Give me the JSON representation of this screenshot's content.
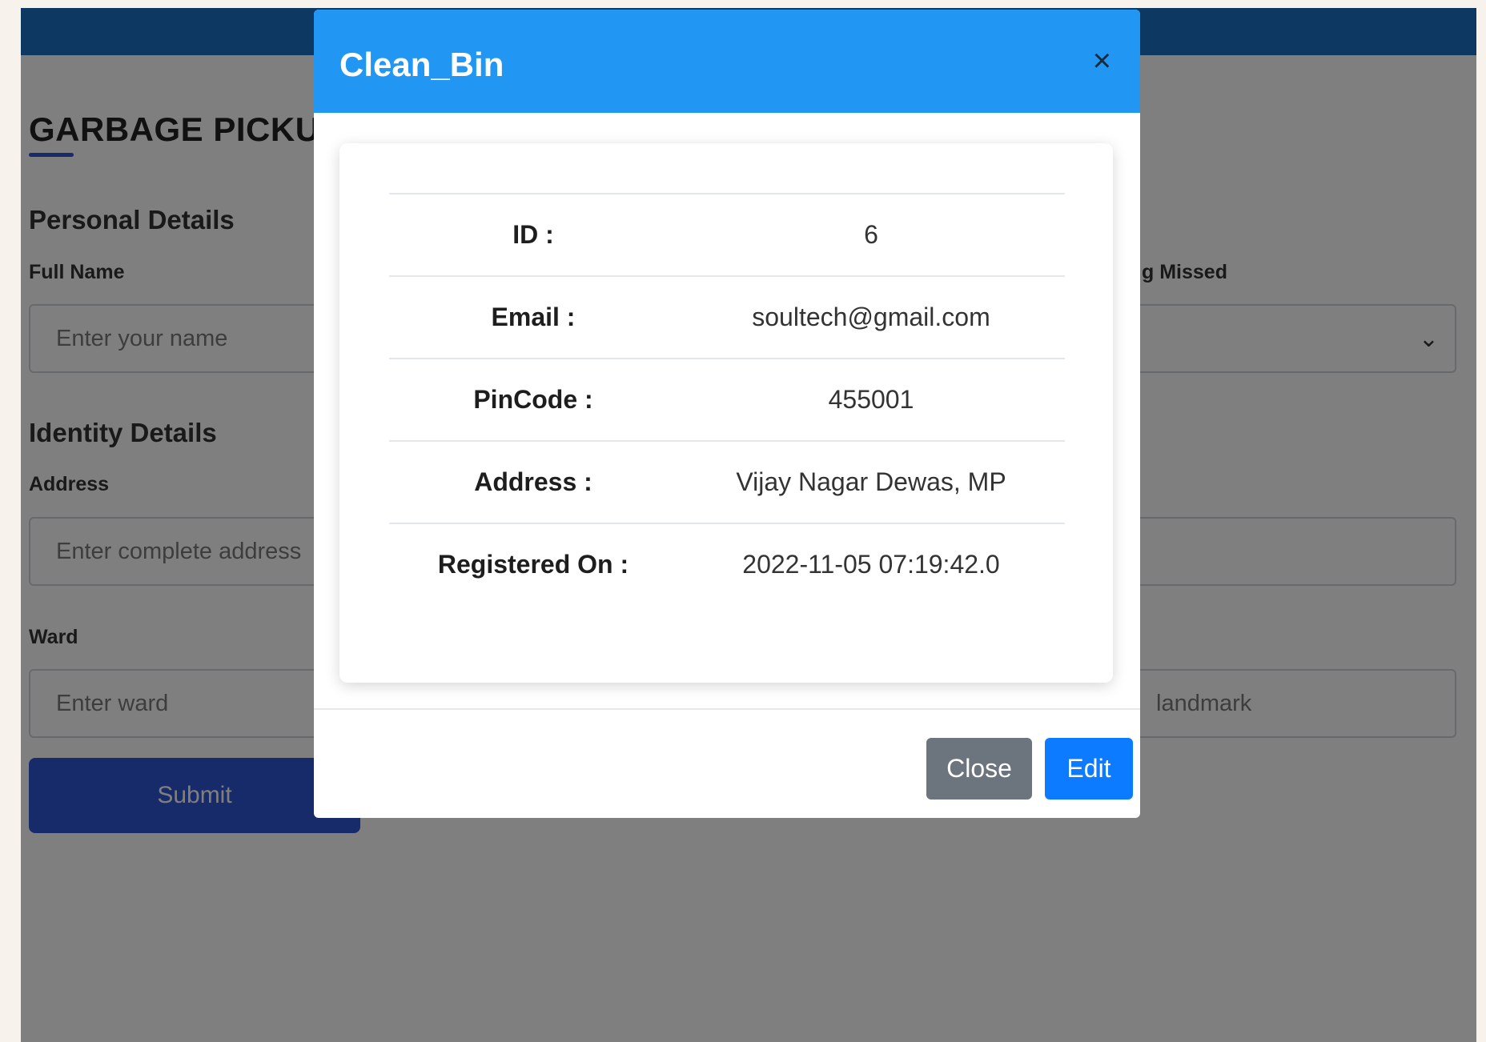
{
  "form": {
    "title": "GARBAGE PICKUP",
    "personal_section": "Personal Details",
    "full_name_label": "Full Name",
    "full_name_placeholder": "Enter your name",
    "right_label_partial": "g Missed",
    "identity_section": "Identity Details",
    "address_label": "Address",
    "address_placeholder": "Enter complete address",
    "ward_label": "Ward",
    "ward_placeholder": "Enter ward",
    "landmark_placeholder": "landmark",
    "submit_label": "Submit"
  },
  "modal": {
    "title": "Clean_Bin",
    "close_x": "×",
    "rows": [
      {
        "label": "ID :",
        "value": "6"
      },
      {
        "label": "Email :",
        "value": "soultech@gmail.com"
      },
      {
        "label": "PinCode :",
        "value": "455001"
      },
      {
        "label": "Address :",
        "value": "Vijay Nagar Dewas, MP"
      },
      {
        "label": "Registered On :",
        "value": "2022-11-05 07:19:42.0"
      }
    ],
    "close_label": "Close",
    "edit_label": "Edit"
  },
  "colors": {
    "topbar": "#1a70c4",
    "modal_header": "#2196f3",
    "submit": "#2f55d4",
    "edit_button": "#0d7bff",
    "close_button": "#6c757d"
  }
}
